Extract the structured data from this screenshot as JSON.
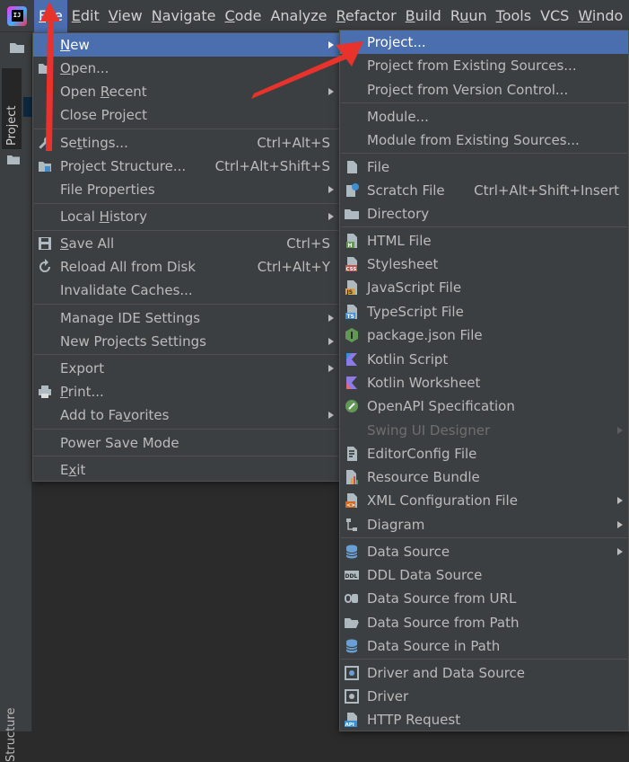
{
  "app": {
    "logo_text": "IJ"
  },
  "menubar": {
    "items": [
      {
        "key": "F",
        "rest": "ile"
      },
      {
        "key": "E",
        "rest": "dit"
      },
      {
        "key": "V",
        "rest": "iew"
      },
      {
        "key": "N",
        "rest": "avigate"
      },
      {
        "key": "C",
        "rest": "ode"
      },
      {
        "key": "",
        "rest": "Analyze"
      },
      {
        "key": "R",
        "rest": "efactor"
      },
      {
        "key": "B",
        "rest": "uild"
      },
      {
        "key": "",
        "rest": "R",
        "tail": "un",
        "underline_mid": "u"
      },
      {
        "key": "T",
        "rest": "ools"
      },
      {
        "key": "",
        "rest": "VCS"
      },
      {
        "key": "W",
        "rest": "indo"
      }
    ]
  },
  "sidebar": {
    "project_tab": "Project",
    "bottom_tab": "Structure"
  },
  "file_menu": {
    "new": {
      "pre": "",
      "key": "N",
      "post": "ew"
    },
    "open": {
      "pre": "",
      "key": "O",
      "post": "pen..."
    },
    "open_recent": {
      "pre": "Open ",
      "key": "R",
      "post": "ecent"
    },
    "close_project": "Close Project",
    "settings": {
      "pre": "Se",
      "key": "t",
      "post": "tings...",
      "shortcut": "Ctrl+Alt+S"
    },
    "project_structure": {
      "label": "Project Structure...",
      "shortcut": "Ctrl+Alt+Shift+S"
    },
    "file_properties": "File Properties",
    "local_history": {
      "pre": "Local ",
      "key": "H",
      "post": "istory"
    },
    "save_all": {
      "pre": "",
      "key": "S",
      "post": "ave All",
      "shortcut": "Ctrl+S"
    },
    "reload": {
      "label": "Reload All from Disk",
      "shortcut": "Ctrl+Alt+Y"
    },
    "invalidate": "Invalidate Caches...",
    "manage_ide": "Manage IDE Settings",
    "new_projects_settings": "New Projects Settings",
    "export": "Export",
    "print": {
      "pre": "",
      "key": "P",
      "post": "rint..."
    },
    "add_fav": {
      "pre": "Add to Fa",
      "key": "v",
      "post": "orites"
    },
    "power_save": "Power Save Mode",
    "exit": {
      "pre": "E",
      "key": "x",
      "post": "it"
    }
  },
  "new_menu": {
    "project": "Project...",
    "project_existing": "Project from Existing Sources...",
    "project_vcs": "Project from Version Control...",
    "module": "Module...",
    "module_existing": "Module from Existing Sources...",
    "file": "File",
    "scratch": {
      "label": "Scratch File",
      "shortcut": "Ctrl+Alt+Shift+Insert"
    },
    "directory": "Directory",
    "html": "HTML File",
    "stylesheet": "Stylesheet",
    "javascript": "JavaScript File",
    "typescript": "TypeScript File",
    "package_json": "package.json File",
    "kotlin_script": "Kotlin Script",
    "kotlin_worksheet": "Kotlin Worksheet",
    "openapi": "OpenAPI Specification",
    "swing": "Swing UI Designer",
    "editorconfig": "EditorConfig File",
    "resource_bundle": "Resource Bundle",
    "xml_config": "XML Configuration File",
    "diagram": "Diagram",
    "data_source": "Data Source",
    "ddl_data_source": "DDL Data Source",
    "ds_url": "Data Source from URL",
    "ds_path": "Data Source from Path",
    "ds_in_path": "Data Source in Path",
    "driver_ds": "Driver and Data Source",
    "driver": "Driver",
    "http_request": "HTTP Request"
  },
  "icon_text": {
    "html": "H",
    "css": "CSS",
    "js": "JS",
    "ts": "TS",
    "xml": "<>",
    "ddl": "DDL",
    "api": "API"
  },
  "colors": {
    "selection": "#4b6eaf",
    "menu_bg": "#3c3f41",
    "annotation_arrow": "#e8322c"
  }
}
